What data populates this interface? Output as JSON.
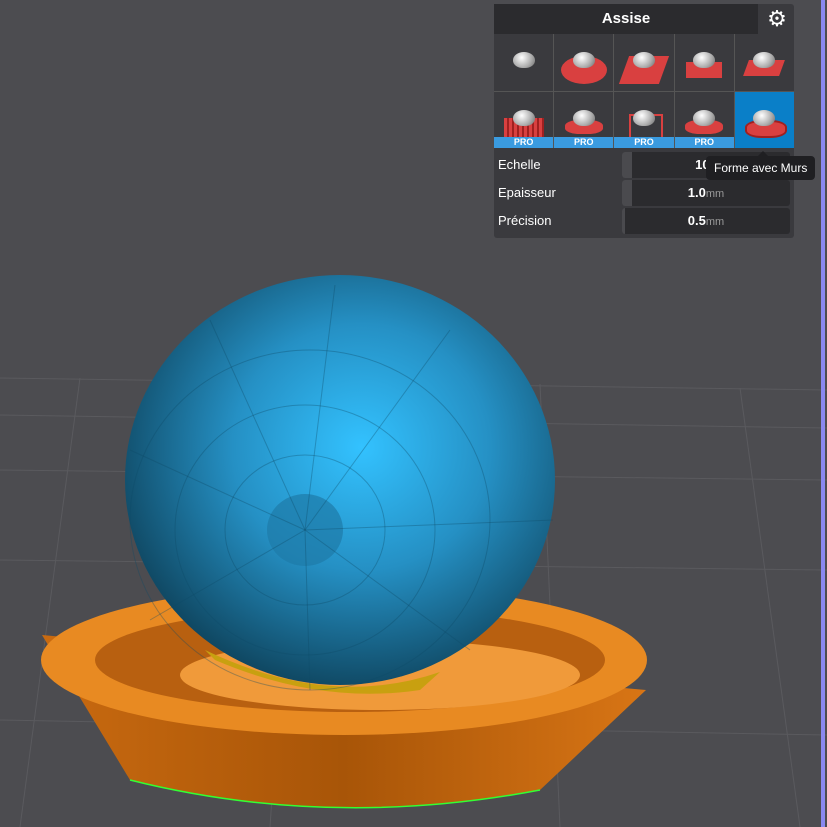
{
  "panel": {
    "title": "Assise",
    "settings_icon": "gear-icon",
    "options": [
      {
        "name": "none",
        "pro": false
      },
      {
        "name": "disc",
        "pro": false
      },
      {
        "name": "square",
        "pro": false
      },
      {
        "name": "contour",
        "pro": false
      },
      {
        "name": "rect",
        "pro": false
      },
      {
        "name": "grid",
        "pro": true
      },
      {
        "name": "shape",
        "pro": true
      },
      {
        "name": "cage",
        "pro": true
      },
      {
        "name": "shape2",
        "pro": true
      },
      {
        "name": "walls",
        "pro": false,
        "selected": true
      }
    ],
    "pro_label": "PRO",
    "fields": [
      {
        "label": "Echelle",
        "value": "100",
        "unit": ""
      },
      {
        "label": "Epaisseur",
        "value": "1.0",
        "unit": "mm"
      },
      {
        "label": "Précision",
        "value": "0.5",
        "unit": "mm"
      }
    ]
  },
  "tooltip": "Forme avec Murs",
  "colors": {
    "accent": "#0a7fc8",
    "pro": "#3a9be0",
    "sphere": "#2a9fd6",
    "bowl": "#e07f1a"
  }
}
